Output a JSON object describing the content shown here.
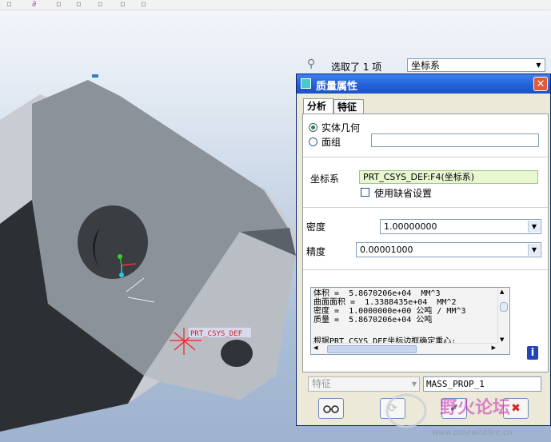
{
  "selection": {
    "status": "选取了 1 项",
    "filter": "坐标系"
  },
  "dialog": {
    "title": "质量属性",
    "tabs": [
      "分析",
      "特征"
    ],
    "geometry_option_solid": "实体几何",
    "geometry_option_quilt": "面组",
    "csys_label": "坐标系",
    "csys_value": "PRT_CSYS_DEF:F4(坐标系)",
    "use_default_label": "使用缺省设置",
    "density_label": "密度",
    "density_value": "1.00000000",
    "accuracy_label": "精度",
    "accuracy_value": "0.00001000",
    "results": [
      "体积 =  5.8670206e+04  MM^3",
      "曲面面积 =  1.3388435e+04  MM^2",
      "密度 =  1.0000000e+00 公吨 / MM^3",
      "质量 =  5.8670206e+04 公吨",
      "",
      "根据PRT_CSYS_DEF坐标边框确定重心:"
    ],
    "feature_combo": "特征",
    "feature_name": "MASS_PROP_1"
  },
  "model": {
    "csys_label": "PRT_CSYS_DEF"
  },
  "watermark": {
    "brand": "野火论坛",
    "url": "www.proewildfire.cn"
  },
  "colors": {
    "title_bar": "#2563d8",
    "csys_field": "#e8f7d0",
    "part": "#8c929a"
  }
}
